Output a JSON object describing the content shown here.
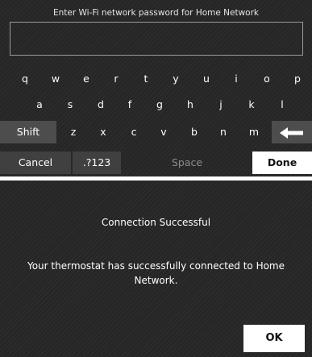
{
  "keyboard_screen": {
    "title": "Enter Wi-Fi network password for Home Network",
    "password_value": "",
    "rows": [
      [
        "q",
        "w",
        "e",
        "r",
        "t",
        "y",
        "u",
        "i",
        "o",
        "p"
      ],
      [
        "a",
        "s",
        "d",
        "f",
        "g",
        "h",
        "j",
        "k",
        "l"
      ],
      [
        "z",
        "x",
        "c",
        "v",
        "b",
        "n",
        "m"
      ]
    ],
    "shift_label": "Shift",
    "backspace_icon": "left-arrow-icon",
    "cancel_label": "Cancel",
    "symbols_label": ".?123",
    "space_label": "Space",
    "done_label": "Done"
  },
  "message_screen": {
    "heading": "Connection Successful",
    "message": "Your thermostat has successfully connected to Home Network.",
    "ok_label": "OK"
  },
  "colors": {
    "background": "#262626",
    "key_dark": "#4d4d4d",
    "button_light": "#ffffff"
  }
}
